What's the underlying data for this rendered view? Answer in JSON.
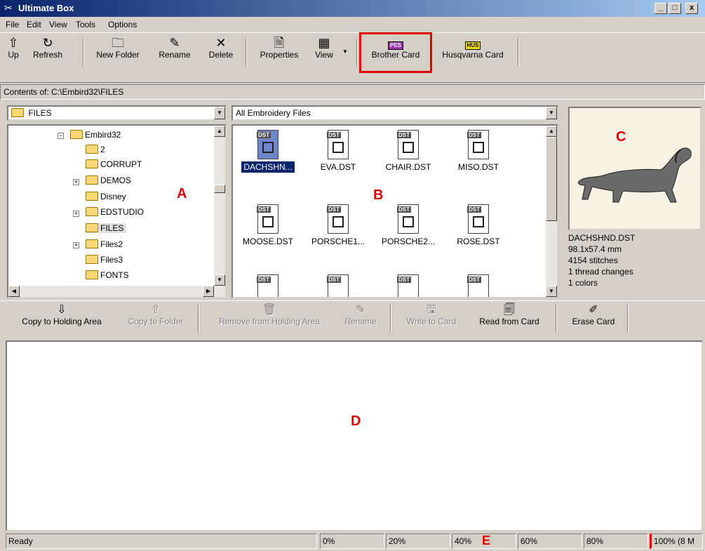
{
  "window": {
    "title": "Ultimate Box",
    "min": "_",
    "max": "□",
    "close": "x"
  },
  "menu": [
    "File",
    "Edit",
    "View",
    "Tools",
    "Options"
  ],
  "toolbar": {
    "up": "Up",
    "refresh": "Refresh",
    "new_folder": "New Folder",
    "rename": "Rename",
    "delete": "Delete",
    "properties": "Properties",
    "view": "View",
    "brother_card": "Brother Card",
    "brother_icon": "PES",
    "husqvarna_card": "Husqvarna Card",
    "husqvarna_icon": "HUS"
  },
  "path": "Contents of: C:\\Embird32\\FILES",
  "folder_combo": "FILES",
  "filter_combo": "All Embroidery Files",
  "tree": [
    "Embird32",
    "2",
    "CORRUPT",
    "DEMOS",
    "Disney",
    "EDSTUDIO",
    "FILES",
    "Files2",
    "Files3",
    "FONTS"
  ],
  "file_icon_tag": "DST",
  "files": [
    "DACHSHN...",
    "EVA.DST",
    "CHAIR.DST",
    "MISO.DST",
    "MOOSE.DST",
    "PORSCHE1...",
    "PORSCHE2...",
    "ROSE.DST"
  ],
  "preview": {
    "filename": "DACHSHND.DST",
    "size": "98.1x57.4 mm",
    "stitches": "4154 stitches",
    "thread_changes": "1 thread changes",
    "colors": "1 colors"
  },
  "holding_toolbar": {
    "copy_to_holding": "Copy to Holding Area",
    "copy_to_folder": "Copy to Folder",
    "remove_from_holding": "Remove from Holding Area",
    "rename": "Rename",
    "write_to_card": "Write to Card",
    "read_from_card": "Read from Card",
    "erase_card": "Erase Card"
  },
  "labels": {
    "a": "A",
    "b": "B",
    "c": "C",
    "d": "D",
    "e": "E"
  },
  "status": {
    "ready": "Ready",
    "p0": "0%",
    "p20": "20%",
    "p40": "40%",
    "p60": "60%",
    "p80": "80%",
    "p100": "100% (8 M"
  },
  "colors": {
    "highlight": "#e00000",
    "selection": "#0a246a",
    "title_start": "#0a246a"
  }
}
